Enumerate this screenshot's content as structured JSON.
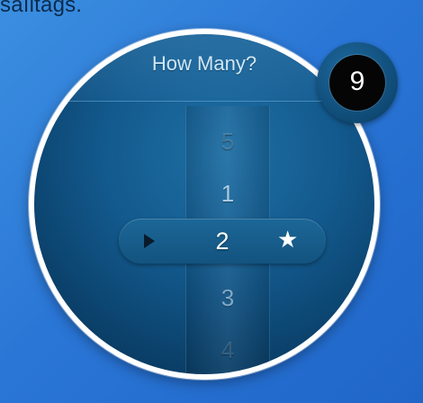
{
  "partial_text": "saıltags.",
  "dial": {
    "title": "How Many?",
    "options": [
      "5",
      "1",
      "2",
      "3",
      "4"
    ],
    "selected": "2"
  },
  "badge": {
    "count": "9"
  },
  "icons": {
    "play": "play-icon",
    "star": "star-icon"
  },
  "colors": {
    "background": "#2a76d6",
    "dial": "#135a8e",
    "badge": "#050505"
  }
}
